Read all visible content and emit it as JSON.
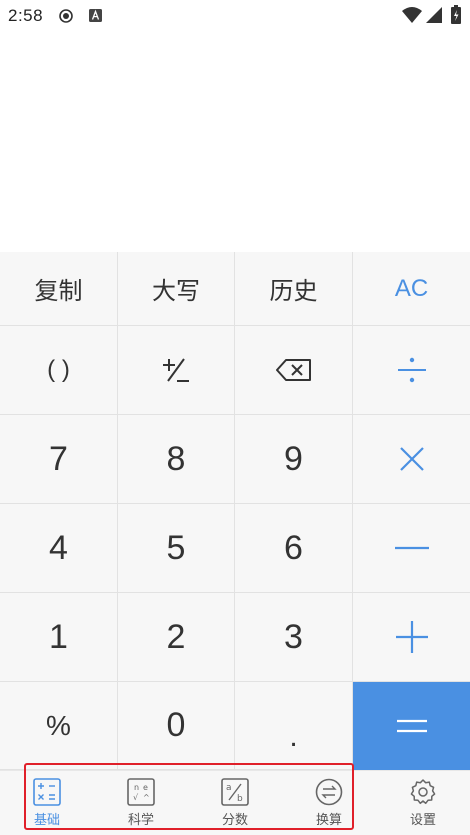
{
  "status_bar": {
    "time": "2:58"
  },
  "top_row": {
    "copy": "复制",
    "upper": "大写",
    "history": "历史",
    "ac": "AC"
  },
  "row2": {
    "paren": "( )",
    "sign": "+/−",
    "backspace": "⌫",
    "divide": "÷"
  },
  "digits": {
    "d7": "7",
    "d8": "8",
    "d9": "9",
    "d4": "4",
    "d5": "5",
    "d6": "6",
    "d1": "1",
    "d2": "2",
    "d3": "3",
    "d0": "0"
  },
  "operators": {
    "multiply": "×",
    "minus": "—",
    "plus": "+",
    "percent": "%",
    "dot": ".",
    "equals": "="
  },
  "nav": {
    "items": [
      {
        "label": "基础",
        "active": true
      },
      {
        "label": "科学",
        "active": false
      },
      {
        "label": "分数",
        "active": false
      },
      {
        "label": "换算",
        "active": false
      },
      {
        "label": "设置",
        "active": false
      }
    ]
  },
  "colors": {
    "accent": "#4a90e2",
    "highlight": "#e0202a",
    "key_bg": "#f7f7f7"
  }
}
